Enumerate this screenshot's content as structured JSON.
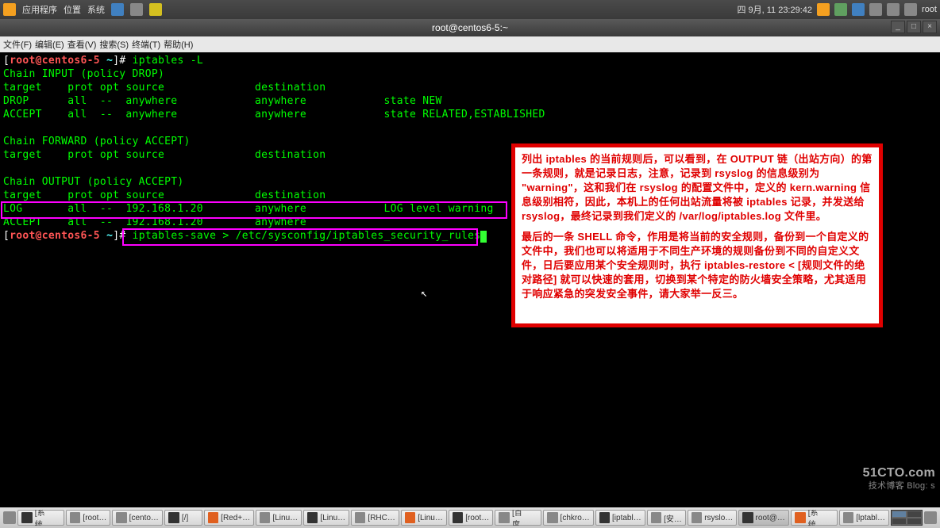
{
  "top_panel": {
    "apps": "应用程序",
    "places": "位置",
    "system": "系统",
    "datetime": "四 9月, 11 23:29:42",
    "user": "root"
  },
  "window": {
    "title": "root@centos6-5:~",
    "min": "_",
    "max": "□",
    "close": "×"
  },
  "menu": {
    "file": "文件(F)",
    "edit": "编辑(E)",
    "view": "查看(V)",
    "search": "搜索(S)",
    "terminal": "终端(T)",
    "help": "帮助(H)"
  },
  "term": {
    "prompt_user": "root@centos6-5",
    "prompt_path": "~",
    "cmd1": "iptables -L",
    "chain_input": "Chain INPUT (policy DROP)",
    "header": "target    prot opt source              destination         ",
    "drop_line": "DROP      all  --  anywhere            anywhere            state NEW ",
    "accept_line": "ACCEPT    all  --  anywhere            anywhere            state RELATED,ESTABLISHED ",
    "chain_fwd": "Chain FORWARD (policy ACCEPT)",
    "header2": "target    prot opt source              destination         ",
    "chain_out": "Chain OUTPUT (policy ACCEPT)",
    "header3": "target    prot opt source              destination         ",
    "log_line": "LOG       all  --  192.168.1.20        anywhere            LOG level warning ",
    "accept2": "ACCEPT    all  --  192.168.1.20        anywhere            ",
    "cmd2": "iptables-save > /etc/sysconfig/iptables_security_rules"
  },
  "annotation": {
    "p1": "列出 iptables 的当前规则后，可以看到，在 OUTPUT 链（出站方向）的第一条规则，就是记录日志，注意，记录到 rsyslog 的信息级别为 \"warning\"，这和我们在 rsyslog 的配置文件中，定义的 kern.warning 信息级别相符，因此，本机上的任何出站流量将被 iptables 记录，并发送给 rsyslog，最终记录到我们定义的 /var/log/iptables.log 文件里。",
    "p2": "最后的一条 SHELL 命令，作用是将当前的安全规则，备份到一个自定义的文件中，我们也可以将适用于不同生产环境的规则备份到不同的自定义文件，日后要应用某个安全规则时，执行 iptables-restore < [规则文件的绝对路径] 就可以快速的套用，切换到某个特定的防火墙安全策略，尤其适用于响应紧急的突发安全事件，请大家举一反三。"
  },
  "taskbar": {
    "items": [
      "[系统…",
      "[root…",
      "[cento…",
      "[/]",
      "[Red+…",
      "[Linu…",
      "[Linu…",
      "[RHC…",
      "[Linu…",
      "[root…",
      "[百度…",
      "[chkro…",
      "[iptabl…",
      "[安…",
      "rsyslo…",
      "root@…",
      "[系统…",
      "[lptabl…"
    ]
  },
  "watermark": {
    "line1": "51CTO.com",
    "line2": "技术博客  Blog: s"
  }
}
